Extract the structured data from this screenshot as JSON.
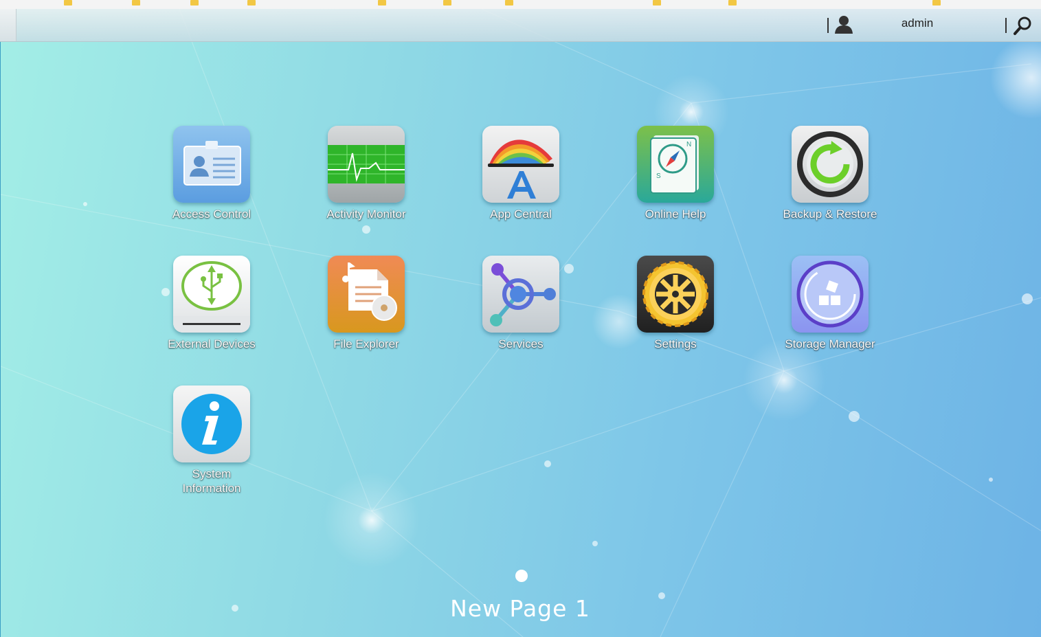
{
  "header": {
    "username": "admin"
  },
  "apps": [
    {
      "label": "Access Control",
      "icon": "id-card-icon"
    },
    {
      "label": "Activity Monitor",
      "icon": "heartbeat-monitor-icon"
    },
    {
      "label": "App Central",
      "icon": "app-central-icon"
    },
    {
      "label": "Online Help",
      "icon": "compass-book-icon"
    },
    {
      "label": "Backup & Restore",
      "icon": "backup-restore-icon"
    },
    {
      "label": "External Devices",
      "icon": "usb-icon"
    },
    {
      "label": "File Explorer",
      "icon": "file-explorer-icon"
    },
    {
      "label": "Services",
      "icon": "services-nodes-icon"
    },
    {
      "label": "Settings",
      "icon": "gear-icon"
    },
    {
      "label": "Storage Manager",
      "icon": "storage-manager-icon"
    },
    {
      "label": "System Information",
      "icon": "info-icon"
    }
  ],
  "page": {
    "title": "New Page 1"
  },
  "colors": {
    "background_start": "#a3eee6",
    "background_end": "#6db3e6",
    "label_text": "#ffffff"
  }
}
